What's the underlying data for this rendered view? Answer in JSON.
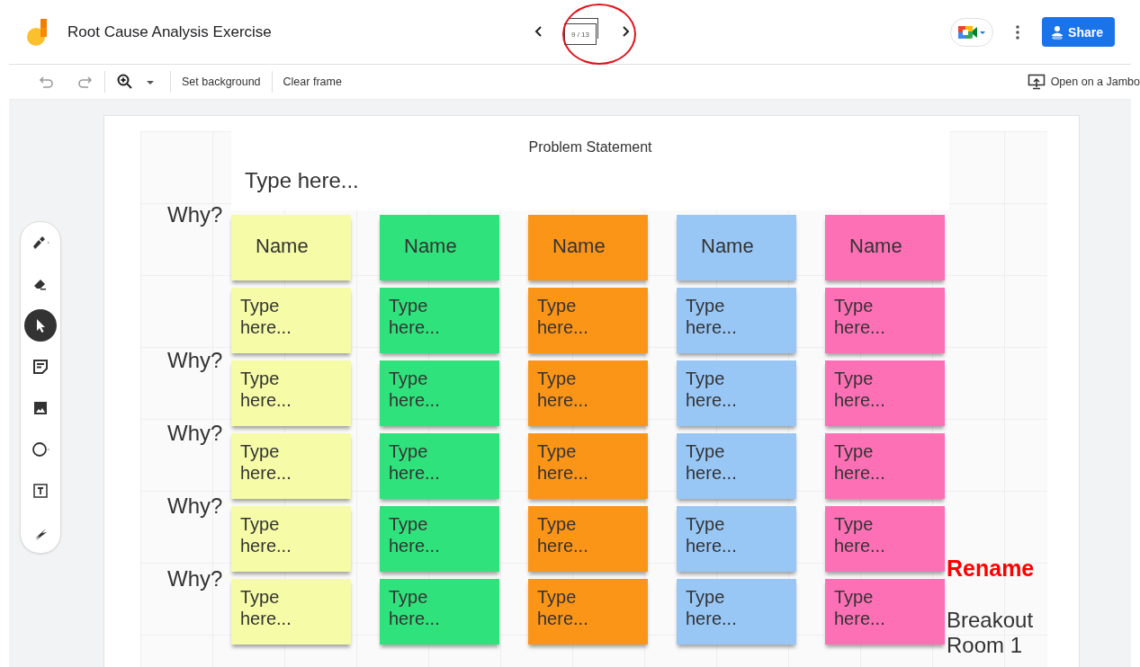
{
  "header": {
    "title": "Root Cause Analysis Exercise",
    "frame_counter": "9 / 13",
    "share_label": "Share"
  },
  "toolbar": {
    "items": [
      "Set background",
      "Clear frame"
    ],
    "open_label": "Open on a Jambo"
  },
  "tools": [
    {
      "kind": "pen",
      "selected": false
    },
    {
      "kind": "eraser",
      "selected": false
    },
    {
      "kind": "select",
      "selected": true
    },
    {
      "kind": "note",
      "selected": false
    },
    {
      "kind": "image",
      "selected": false
    },
    {
      "kind": "circle",
      "selected": false
    },
    {
      "kind": "textbox",
      "selected": false
    },
    {
      "kind": "laser",
      "selected": false
    }
  ],
  "problem": {
    "title": "Problem Statement",
    "text": "Type here..."
  },
  "rows": [
    {
      "why": "Why?",
      "notes": [
        {
          "text": "Name",
          "color": "#f5fba6"
        },
        {
          "text": "Name",
          "color": "#30e27b"
        },
        {
          "text": "Name",
          "color": "#fb9518"
        },
        {
          "text": "Name",
          "color": "#98c7f6"
        },
        {
          "text": "Name",
          "color": "#fd70b6"
        }
      ]
    },
    {
      "notes": [
        {
          "text": "Type here...",
          "color": "#f5fba6"
        },
        {
          "text": "Type here...",
          "color": "#30e27b"
        },
        {
          "text": "Type here...",
          "color": "#fb9518"
        },
        {
          "text": "Type here...",
          "color": "#98c7f6"
        },
        {
          "text": "Type here...",
          "color": "#fd70b6"
        }
      ]
    },
    {
      "why": "Why?",
      "notes": [
        {
          "text": "Type here...",
          "color": "#f5fba6"
        },
        {
          "text": "Type here...",
          "color": "#30e27b"
        },
        {
          "text": "Type here...",
          "color": "#fb9518"
        },
        {
          "text": "Type here...",
          "color": "#98c7f6"
        },
        {
          "text": "Type here...",
          "color": "#fd70b6"
        }
      ]
    },
    {
      "why": "Why?",
      "notes": [
        {
          "text": "Type here...",
          "color": "#f5fba6"
        },
        {
          "text": "Type here...",
          "color": "#30e27b"
        },
        {
          "text": "Type here...",
          "color": "#fb9518"
        },
        {
          "text": "Type here...",
          "color": "#98c7f6"
        },
        {
          "text": "Type here...",
          "color": "#fd70b6"
        }
      ]
    },
    {
      "why": "Why?",
      "notes": [
        {
          "text": "Type here...",
          "color": "#f5fba6"
        },
        {
          "text": "Type here...",
          "color": "#30e27b"
        },
        {
          "text": "Type here...",
          "color": "#fb9518"
        },
        {
          "text": "Type here...",
          "color": "#98c7f6"
        },
        {
          "text": "Type here...",
          "color": "#fd70b6"
        }
      ]
    },
    {
      "why": "Why?",
      "notes": [
        {
          "text": "Type here...",
          "color": "#f5fba6"
        },
        {
          "text": "Type here...",
          "color": "#30e27b"
        },
        {
          "text": "Type here...",
          "color": "#fb9518"
        },
        {
          "text": "Type here...",
          "color": "#98c7f6"
        },
        {
          "text": "Type here...",
          "color": "#fd70b6"
        }
      ]
    }
  ],
  "annotation": "Rename",
  "room_label": "Breakout Room 1"
}
